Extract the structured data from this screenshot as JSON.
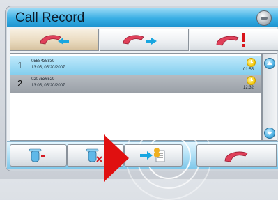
{
  "window": {
    "title": "Call Record",
    "close_icon": "minimize-circle-icon"
  },
  "tabs": [
    {
      "name": "received",
      "icon": "phone-incoming-icon",
      "active": true
    },
    {
      "name": "dialed",
      "icon": "phone-outgoing-icon",
      "active": false
    },
    {
      "name": "missed",
      "icon": "phone-missed-icon",
      "active": false
    }
  ],
  "records": [
    {
      "index": "1",
      "number": "0558435839",
      "datetime": "13:05, 05/20/2007",
      "duration": "01:55",
      "selected": true
    },
    {
      "index": "2",
      "number": "0207536529",
      "datetime": "13:05, 05/20/2007",
      "duration": "12:32",
      "selected": false
    }
  ],
  "bottom_toolbar": {
    "delete_one_icon": "delete-record-icon",
    "delete_all_icon": "delete-all-icon",
    "save_contact_icon": "save-to-contacts-icon",
    "dial_icon": "dial-phone-icon"
  },
  "colors": {
    "title_bar": "#39aee4",
    "phone_red": "#e0405a",
    "arrow_blue": "#18a6e0",
    "pointer_red": "#e01010",
    "selected_row": "#84cfee"
  }
}
